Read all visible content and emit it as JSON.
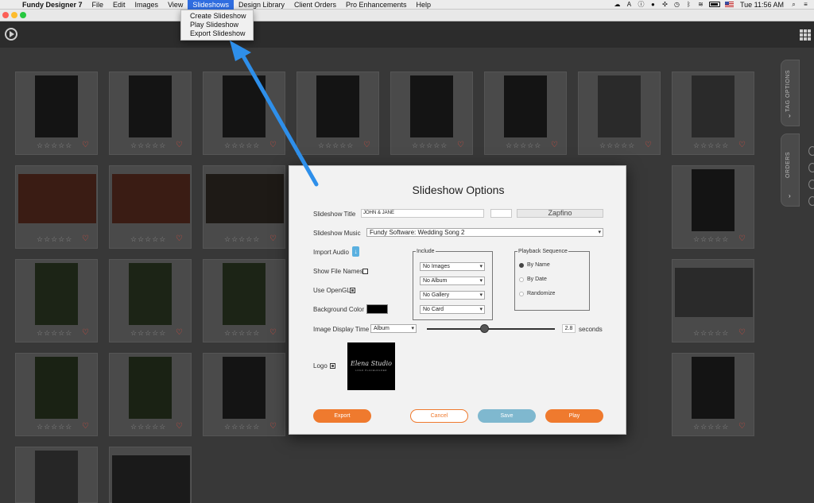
{
  "menubar": {
    "app_name": "Fundy Designer 7",
    "items": [
      "File",
      "Edit",
      "Images",
      "View",
      "Slideshows",
      "Design Library",
      "Client Orders",
      "Pro Enhancements",
      "Help"
    ],
    "active_item": "Slideshows",
    "clock": "Tue 11:56 AM"
  },
  "slideshow_menu": {
    "items": [
      "Create Slideshow",
      "Play Slideshow",
      "Export Slideshow"
    ]
  },
  "grid": {
    "stars": "☆☆☆☆☆",
    "heart": "♡"
  },
  "side_tabs": {
    "tag_options": "TAG OPTIONS",
    "orders": "ORDERS",
    "chevron": "›"
  },
  "modal": {
    "title": "Slideshow Options",
    "slideshow_title_label": "Slideshow Title",
    "slideshow_title_value": "JOHN & JANE",
    "font_name": "Zapfino",
    "music_label": "Slideshow Music",
    "music_value": "Fundy Software: Wedding Song 2",
    "import_audio_label": "Import Audio",
    "show_file_names_label": "Show File Names",
    "use_opengl_label": "Use OpenGL",
    "background_color_label": "Background Color",
    "background_color": "#000000",
    "include_legend": "Include",
    "include_options": [
      "No Images",
      "No Album",
      "No Gallery",
      "No Card"
    ],
    "playback_legend": "Playback Sequence",
    "playback_options": [
      "By Name",
      "By Date",
      "Randomize"
    ],
    "playback_selected": "By Name",
    "display_time_label": "Image Display Time",
    "display_time_select": "Album",
    "display_time_value": "2.8",
    "seconds_label": "seconds",
    "slider_fraction": 0.45,
    "logo_label": "Logo",
    "logo_script": "Elena Studio",
    "logo_sub": "LOGO PLACEHOLDER",
    "buttons": {
      "export": "Export",
      "cancel": "Cancel",
      "save": "Save",
      "play": "Play"
    }
  },
  "colors": {
    "accent_orange": "#ef7a2e",
    "save_blue": "#7fb8cf",
    "menu_highlight": "#2f6de0",
    "arrow_blue": "#2e8fea"
  }
}
